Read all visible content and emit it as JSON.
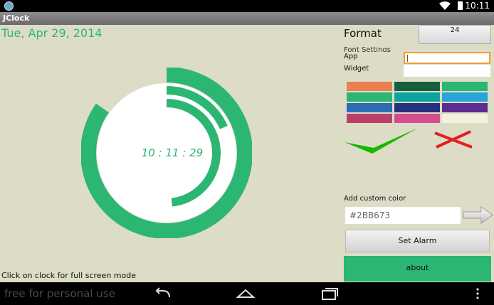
{
  "status_bar": {
    "time": "10:11",
    "icons": [
      "app-notification-icon",
      "wifi-icon",
      "battery-icon"
    ]
  },
  "app": {
    "title": "JClock"
  },
  "date_text": "Tue, Apr 29, 2014",
  "clock": {
    "time_text": "10 : 11 : 29",
    "color": "#2bb673",
    "hour_fraction": 0.8472,
    "minute_fraction": 0.1833,
    "second_fraction": 0.4833
  },
  "hint_text": "Click on clock for full screen mode",
  "settings": {
    "format_label": "Format",
    "format_value": "24",
    "font_settings_label": "Font Settings",
    "app_label": "App",
    "widget_label": "Widget",
    "app_value": "",
    "widget_value": ""
  },
  "palette": {
    "colors": [
      [
        "#e9804f",
        "#155f3e",
        "#2bb673"
      ],
      [
        "#2bb673",
        "#0ea49b",
        "#29a4d9"
      ],
      [
        "#2a6fb3",
        "#24317f",
        "#5b2c92"
      ],
      [
        "#b9406a",
        "#d64d8e",
        "#f3f2df"
      ]
    ],
    "confirm_icon": "checkmark-icon",
    "cancel_icon": "cross-icon",
    "confirm_color": "#17b800",
    "cancel_color": "#e11f1f"
  },
  "custom_color": {
    "label": "Add custom color",
    "value": "#2BB673"
  },
  "buttons": {
    "set_alarm": "Set Alarm",
    "about": "about"
  },
  "nav_bar": {
    "watermark": "free for personal use",
    "icons": [
      "back-icon",
      "home-icon",
      "recents-icon",
      "overflow-menu-icon"
    ]
  }
}
